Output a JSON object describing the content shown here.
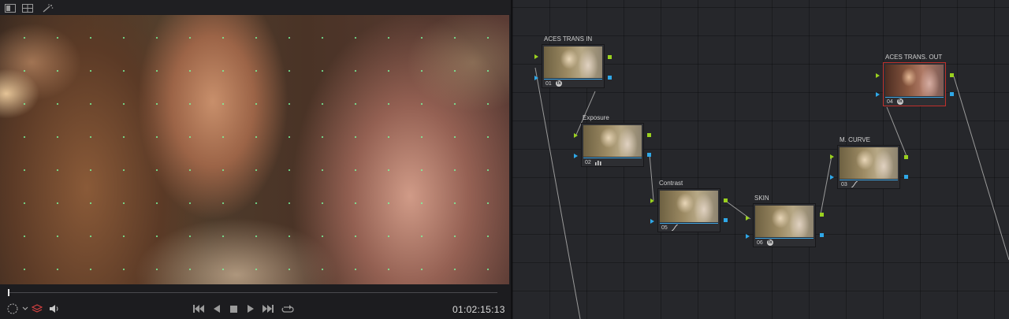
{
  "viewer": {
    "toolbar": {
      "icons": [
        "single-viewer-icon",
        "split-screen-icon",
        "magic-wand-icon"
      ]
    },
    "transport": {
      "left_icons": [
        "overlay-selector-icon",
        "layers-icon",
        "volume-icon"
      ],
      "controls": [
        "go-to-first-frame",
        "reverse-play",
        "stop",
        "play",
        "go-to-last-frame",
        "loop"
      ],
      "timecode": "01:02:15:13",
      "playhead_position": 0.0
    }
  },
  "node_graph": {
    "nodes": [
      {
        "id": "01",
        "label": "ACES TRANS IN",
        "number": "01",
        "icon": "fx-icon",
        "selected": false
      },
      {
        "id": "02",
        "label": "Exposure",
        "number": "02",
        "icon": "bars-icon",
        "selected": false
      },
      {
        "id": "05",
        "label": "Contrast",
        "number": "05",
        "icon": "curve-icon",
        "selected": false
      },
      {
        "id": "06",
        "label": "SKIN",
        "number": "06",
        "icon": "fx-icon",
        "selected": false
      },
      {
        "id": "03",
        "label": "M. CURVE",
        "number": "03",
        "icon": "curve-icon",
        "selected": false
      },
      {
        "id": "04",
        "label": "ACES TRANS.  OUT",
        "number": "04",
        "icon": "fx-icon",
        "selected": true
      }
    ],
    "colors": {
      "rgb_port": "#9ad11f",
      "key_port": "#2fa8e8",
      "selected_border": "#c0302b",
      "wire": "#9a9a9a"
    }
  }
}
